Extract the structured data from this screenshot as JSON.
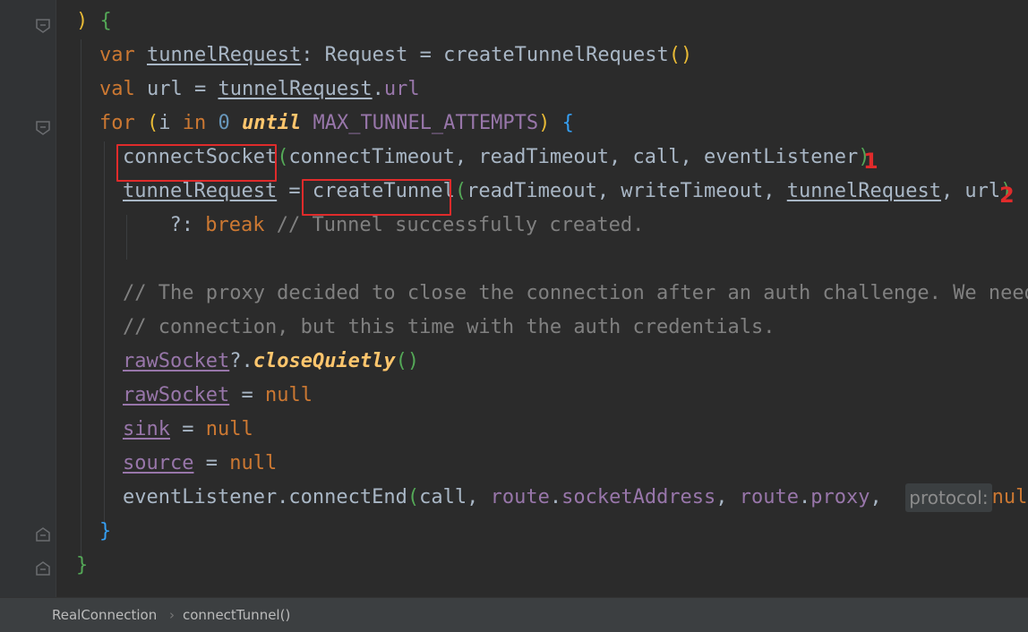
{
  "editor": {
    "lines": [
      {
        "indent": 1,
        "tokens": [
          {
            "t": ")",
            "c": "p1"
          },
          {
            "t": " "
          },
          {
            "t": "{",
            "c": "b2"
          }
        ]
      },
      {
        "indent": 2,
        "tokens": [
          {
            "t": "var",
            "c": "kw"
          },
          {
            "t": " "
          },
          {
            "t": "tunnelRequest",
            "c": "ul"
          },
          {
            "t": ": Request = createTunnelRequest"
          },
          {
            "t": "()",
            "c": "p1"
          }
        ]
      },
      {
        "indent": 2,
        "tokens": [
          {
            "t": "val",
            "c": "kw"
          },
          {
            "t": " url = "
          },
          {
            "t": "tunnelRequest",
            "c": "ul"
          },
          {
            "t": "."
          },
          {
            "t": "url",
            "c": "prop"
          }
        ]
      },
      {
        "indent": 2,
        "tokens": [
          {
            "t": "for",
            "c": "kw"
          },
          {
            "t": " "
          },
          {
            "t": "(",
            "c": "p1"
          },
          {
            "t": "i "
          },
          {
            "t": "in",
            "c": "kw"
          },
          {
            "t": " "
          },
          {
            "t": "0",
            "c": "num"
          },
          {
            "t": " "
          },
          {
            "t": "until",
            "c": "fn"
          },
          {
            "t": " "
          },
          {
            "t": "MAX_TUNNEL_ATTEMPTS",
            "c": "prop"
          },
          {
            "t": ")",
            "c": "p1"
          },
          {
            "t": " "
          },
          {
            "t": "{",
            "c": "b3"
          }
        ]
      },
      {
        "indent": 3,
        "tokens": [
          {
            "t": "connectSocket"
          },
          {
            "t": "(",
            "c": "p2"
          },
          {
            "t": "connectTimeout, readTimeout, call, eventListener"
          },
          {
            "t": ")",
            "c": "p2"
          }
        ]
      },
      {
        "indent": 3,
        "tokens": [
          {
            "t": "tunnelRequest",
            "c": "ul"
          },
          {
            "t": " = createTunnel"
          },
          {
            "t": "(",
            "c": "p2"
          },
          {
            "t": "readTimeout, writeTimeout, "
          },
          {
            "t": "tunnelRequest",
            "c": "ul"
          },
          {
            "t": ", url"
          },
          {
            "t": ")",
            "c": "p2"
          }
        ]
      },
      {
        "indent": 4,
        "tokens": [
          {
            "t": "  ?: "
          },
          {
            "t": "break",
            "c": "kw"
          },
          {
            "t": " // Tunnel successfully created.",
            "c": "cmt"
          }
        ]
      },
      {
        "indent": 3,
        "tokens": []
      },
      {
        "indent": 3,
        "tokens": [
          {
            "t": "// The proxy decided to close the connection after an auth challenge. We need",
            "c": "cmt"
          }
        ]
      },
      {
        "indent": 3,
        "tokens": [
          {
            "t": "// connection, but this time with the auth credentials.",
            "c": "cmt"
          }
        ]
      },
      {
        "indent": 3,
        "tokens": [
          {
            "t": "rawSocket",
            "c": "prop ul"
          },
          {
            "t": "?."
          },
          {
            "t": "closeQuietly",
            "c": "fn"
          },
          {
            "t": "()",
            "c": "p2"
          }
        ]
      },
      {
        "indent": 3,
        "tokens": [
          {
            "t": "rawSocket",
            "c": "prop ul"
          },
          {
            "t": " = "
          },
          {
            "t": "null",
            "c": "kw"
          }
        ]
      },
      {
        "indent": 3,
        "tokens": [
          {
            "t": "sink",
            "c": "prop ul"
          },
          {
            "t": " = "
          },
          {
            "t": "null",
            "c": "kw"
          }
        ]
      },
      {
        "indent": 3,
        "tokens": [
          {
            "t": "source",
            "c": "prop ul"
          },
          {
            "t": " = "
          },
          {
            "t": "null",
            "c": "kw"
          }
        ]
      },
      {
        "indent": 3,
        "tokens": [
          {
            "t": "eventListener.connectEnd"
          },
          {
            "t": "(",
            "c": "p2"
          },
          {
            "t": "call, "
          },
          {
            "t": "route",
            "c": "prop"
          },
          {
            "t": "."
          },
          {
            "t": "socketAddress",
            "c": "prop"
          },
          {
            "t": ", "
          },
          {
            "t": "route",
            "c": "prop"
          },
          {
            "t": "."
          },
          {
            "t": "proxy",
            "c": "prop"
          },
          {
            "t": ",  "
          },
          {
            "hint": "protocol:"
          },
          {
            "t": "null",
            "c": "kw"
          }
        ]
      },
      {
        "indent": 2,
        "tokens": [
          {
            "t": "}",
            "c": "b3"
          }
        ]
      },
      {
        "indent": 1,
        "tokens": [
          {
            "t": "}",
            "c": "b2"
          }
        ]
      }
    ]
  },
  "annotations": {
    "marker_1": "1",
    "marker_2": "2"
  },
  "breadcrumb": {
    "class_name": "RealConnection",
    "separator": "›",
    "method_name": "connectTunnel()"
  },
  "colors": {
    "background": "#2b2b2b",
    "gutter": "#313335",
    "highlight_box": "#e02b2b",
    "keyword": "#cc7832",
    "property": "#9876aa",
    "comment": "#808080",
    "function_italic": "#ffc66d"
  }
}
